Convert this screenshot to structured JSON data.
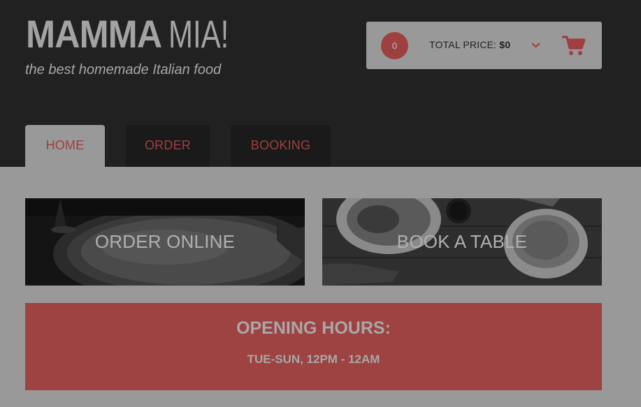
{
  "logo": {
    "bold_part": "MAMMA",
    "light_part": "MIA!",
    "tagline": "the best homemade Italian food"
  },
  "cart": {
    "count": "0",
    "total_label": "TOTAL PRICE:",
    "total_value": "$0",
    "chevron_icon": "chevron-down-icon",
    "cart_icon": "shopping-cart-icon"
  },
  "nav": {
    "tabs": [
      {
        "label": "HOME",
        "active": true
      },
      {
        "label": "ORDER",
        "active": false
      },
      {
        "label": "BOOKING",
        "active": false
      }
    ]
  },
  "tiles": {
    "order": {
      "label": "ORDER ONLINE"
    },
    "book": {
      "label": "BOOK A TABLE"
    }
  },
  "hours": {
    "title": "OPENING HOURS:",
    "times": "TUE-SUN, 12PM - 12AM"
  },
  "colors": {
    "accent": "#9e3f40",
    "header_bg": "#212121",
    "page_bg": "#999999"
  }
}
